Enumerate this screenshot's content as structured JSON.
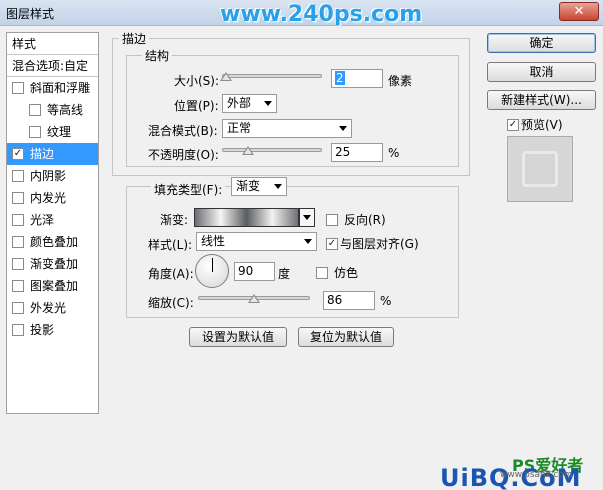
{
  "window": {
    "title": "图层样式",
    "close_glyph": "✕",
    "watermark_top": "www.240ps.com"
  },
  "sidebar": {
    "header": "样式",
    "blend_options": "混合选项:自定",
    "items": [
      {
        "label": "斜面和浮雕",
        "checked": false,
        "sub": false,
        "active": false
      },
      {
        "label": "等高线",
        "checked": false,
        "sub": true,
        "active": false
      },
      {
        "label": "纹理",
        "checked": false,
        "sub": true,
        "active": false
      },
      {
        "label": "描边",
        "checked": true,
        "sub": false,
        "active": true
      },
      {
        "label": "内阴影",
        "checked": false,
        "sub": false,
        "active": false
      },
      {
        "label": "内发光",
        "checked": false,
        "sub": false,
        "active": false
      },
      {
        "label": "光泽",
        "checked": false,
        "sub": false,
        "active": false
      },
      {
        "label": "颜色叠加",
        "checked": false,
        "sub": false,
        "active": false
      },
      {
        "label": "渐变叠加",
        "checked": false,
        "sub": false,
        "active": false
      },
      {
        "label": "图案叠加",
        "checked": false,
        "sub": false,
        "active": false
      },
      {
        "label": "外发光",
        "checked": false,
        "sub": false,
        "active": false
      },
      {
        "label": "投影",
        "checked": false,
        "sub": false,
        "active": false
      }
    ]
  },
  "stroke": {
    "section_title": "描边",
    "structure_title": "结构",
    "size_label": "大小(S):",
    "size_value": "2",
    "size_unit": "像素",
    "position_label": "位置(P):",
    "position_value": "外部",
    "blend_mode_label": "混合模式(B):",
    "blend_mode_value": "正常",
    "opacity_label": "不透明度(O):",
    "opacity_value": "25",
    "opacity_unit": "%",
    "fill_type_label": "填充类型(F):",
    "fill_type_value": "渐变",
    "gradient_label": "渐变:",
    "reverse_label": "反向(R)",
    "reverse_checked": false,
    "style_label": "样式(L):",
    "style_value": "线性",
    "align_label": "与图层对齐(G)",
    "align_checked": true,
    "angle_label": "角度(A):",
    "angle_value": "90",
    "angle_unit": "度",
    "dither_label": "仿色",
    "dither_checked": false,
    "scale_label": "缩放(C):",
    "scale_value": "86",
    "scale_unit": "%",
    "make_default": "设置为默认值",
    "reset_default": "复位为默认值"
  },
  "actions": {
    "ok": "确定",
    "cancel": "取消",
    "new_style": "新建样式(W)...",
    "preview_label": "预览(V)",
    "preview_checked": true
  },
  "watermark_bottom": {
    "brand": "UiBQ.CoM",
    "ps": "PS爱好者",
    "url": "www.psahz.com"
  },
  "colors": {
    "selection": "#3399ff",
    "dialog_bg": "#f0f0f0"
  }
}
